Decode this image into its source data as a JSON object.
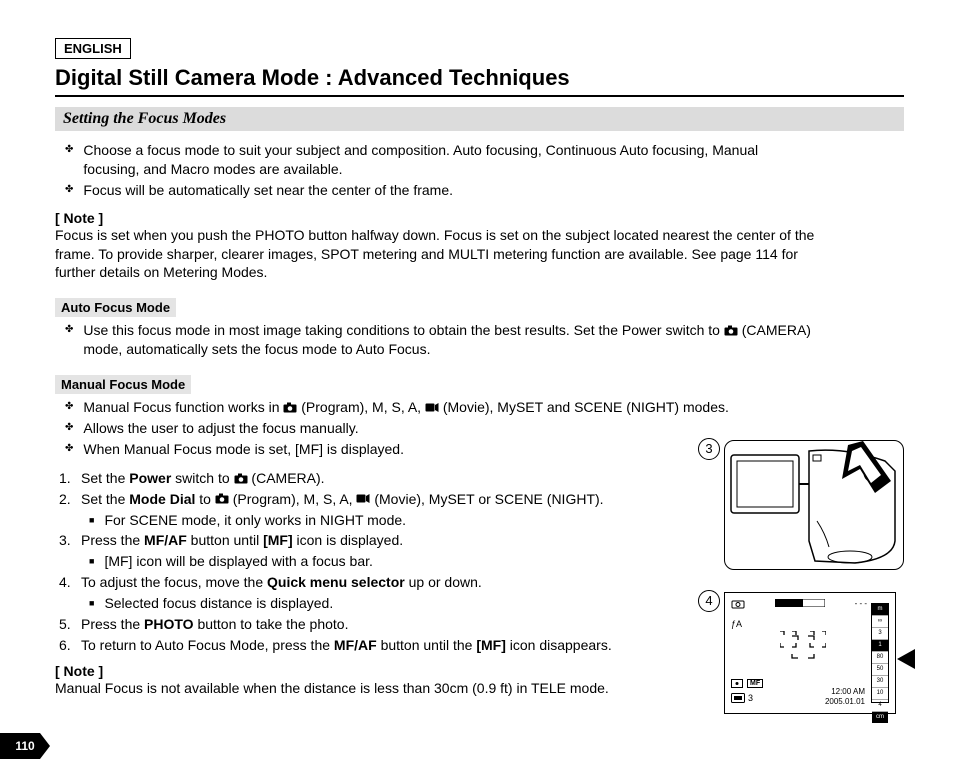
{
  "lang": "ENGLISH",
  "title": "Digital Still Camera Mode : Advanced Techniques",
  "subtitle": "Setting the Focus Modes",
  "intro_bullets": [
    "Choose a focus mode to suit your subject and composition. Auto focusing, Continuous Auto focusing, Manual focusing, and Macro modes are available.",
    "Focus will be automatically set near the center of the frame."
  ],
  "note1_head": "[ Note ]",
  "note1_body": "Focus is set when you push the PHOTO button halfway down. Focus is set on the subject located nearest the center of the frame. To provide sharper, clearer images, SPOT metering and MULTI metering function are available. See page 114 for further details on Metering Modes.",
  "auto_label": "Auto Focus Mode",
  "auto_bullets_pre": "Use this focus mode in most image taking conditions to obtain the best results. Set the Power switch to ",
  "auto_bullets_post": "(CAMERA) mode, automatically sets the focus mode to Auto Focus.",
  "manual_label": "Manual Focus Mode",
  "manual_bullets": {
    "b1_pre": "Manual Focus function works in ",
    "b1_mid": " (Program), M, S, A, ",
    "b1_post": " (Movie), MySET and SCENE (NIGHT) modes.",
    "b2": "Allows the user to adjust the focus manually.",
    "b3": "When Manual Focus mode is set, [MF] is displayed."
  },
  "steps": {
    "s1_pre": "Set the ",
    "s1_b": "Power",
    "s1_post": " switch to ",
    "s1_end": "(CAMERA).",
    "s2_pre": "Set the ",
    "s2_b": "Mode Dial",
    "s2_post": " to ",
    "s2_mid": " (Program), M, S, A, ",
    "s2_end": " (Movie), MySET or SCENE (NIGHT).",
    "s2_sub": "For SCENE mode, it only works in NIGHT mode.",
    "s3_pre": "Press the ",
    "s3_b": "MF/AF",
    "s3_mid": " button until ",
    "s3_b2": "[MF]",
    "s3_post": " icon is displayed.",
    "s3_sub": "[MF] icon will be displayed with a focus bar.",
    "s4_pre": "To adjust the focus, move the ",
    "s4_b": "Quick menu selector",
    "s4_post": " up or down.",
    "s4_sub": "Selected focus distance is displayed.",
    "s5_pre": "Press the ",
    "s5_b": "PHOTO",
    "s5_post": " button to take the photo.",
    "s6_pre": "To return to Auto Focus Mode, press the ",
    "s6_b": "MF/AF",
    "s6_mid": " button until the ",
    "s6_b2": "[MF]",
    "s6_post": " icon disappears."
  },
  "note2_head": "[ Note ]",
  "note2_body": "Manual Focus is not available when the distance is less than 30cm (0.9 ft) in TELE mode.",
  "fig3_num": "3",
  "fig4_num": "4",
  "lcd": {
    "time": "12:00 AM",
    "date": "2005.01.01",
    "flash": "ƒA",
    "mf": "MF",
    "bar_top": "m",
    "bar_vals": [
      "∞",
      "3",
      "1",
      "80",
      "50",
      "30",
      "10",
      "4"
    ],
    "bar_bot": "cm",
    "count": "3",
    "dashes": "- - -"
  },
  "page_num": "110"
}
